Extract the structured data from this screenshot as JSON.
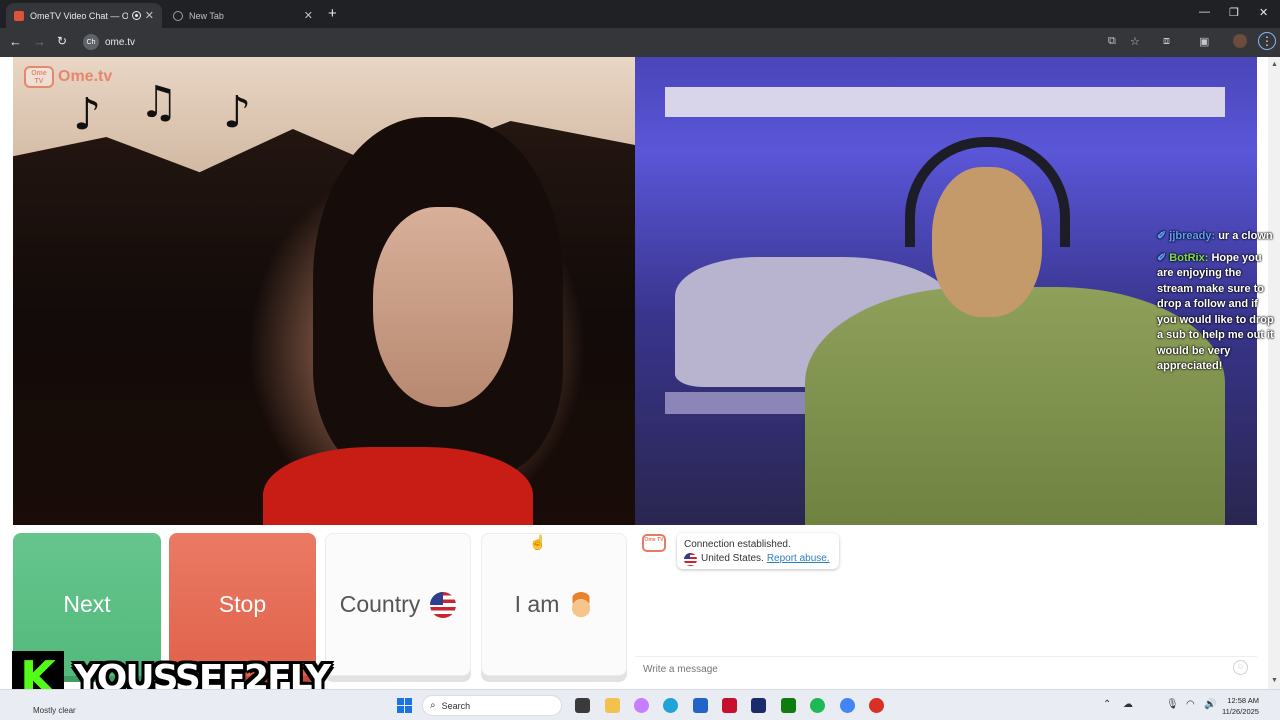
{
  "browser": {
    "tabs": [
      {
        "title": "OmeTV Video Chat — Ome",
        "active": true
      },
      {
        "title": "New Tab",
        "active": false
      }
    ],
    "new_tab_glyph": "+",
    "url": "ome.tv",
    "site_icon_text": "Ch"
  },
  "window_controls": {
    "minimize": "—",
    "maximize": "❐",
    "close": "✕"
  },
  "video": {
    "logo_word": "Ome.tv",
    "logo_tv": "Ome TV"
  },
  "stream_chat": [
    {
      "user": "jjbready:",
      "text": " ur a clown"
    },
    {
      "user": "BotRix:",
      "text": " Hope you are enjoying the stream make sure to drop a follow and if you would like to drop a sub to help me out it would be very appreciated!"
    }
  ],
  "controls": {
    "next_label": "Next",
    "stop_label": "Stop",
    "country_label": "Country",
    "iam_label": "I am"
  },
  "chat": {
    "system_line1": "Connection established.",
    "country": "United States.",
    "report_link": "Report abuse.",
    "input_placeholder": "Write a message"
  },
  "streamer": {
    "platform_glyph": "K",
    "name": "YOUSSEF2FLY"
  },
  "taskbar": {
    "weather": "Mostly clear",
    "search_label": "Search",
    "time": "12:58 AM",
    "date": "11/26/2025"
  },
  "colors": {
    "next": "#5dbf86",
    "stop": "#e56b53",
    "ometv_accent": "#e57b62",
    "kick_green": "#53fc18"
  }
}
